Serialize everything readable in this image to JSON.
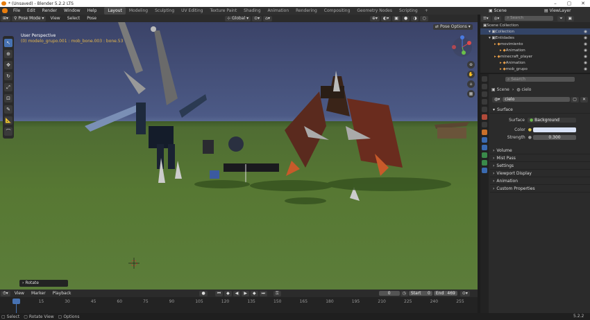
{
  "window": {
    "title": "* (Unsaved) - Blender 5.2.2 LTS",
    "min": "–",
    "max": "▢",
    "close": "✕"
  },
  "menu": [
    "File",
    "Edit",
    "Render",
    "Window",
    "Help"
  ],
  "workspaces": [
    "Layout",
    "Modeling",
    "Sculpting",
    "UV Editing",
    "Texture Paint",
    "Shading",
    "Animation",
    "Rendering",
    "Compositing",
    "Geometry Nodes",
    "Scripting"
  ],
  "active_workspace": "Layout",
  "top_right": {
    "scene": "Scene",
    "view_layer": "ViewLayer"
  },
  "viewport_header": {
    "mode": "Pose Mode",
    "menus": [
      "View",
      "Select",
      "Pose"
    ],
    "transform": "Global",
    "pose_options": "Pose Options"
  },
  "viewport": {
    "perspective": "User Perspective",
    "info": "(0) modelo_grupo.001 : mob_bone.003 : bone.53"
  },
  "last_op": "Rotate",
  "timeline": {
    "menus": [
      "View",
      "Marker",
      "Playback"
    ],
    "current_frame": "0",
    "start_label": "Start",
    "start": "0",
    "end_label": "End",
    "end": "469",
    "ticks": [
      "0",
      "15",
      "30",
      "45",
      "60",
      "75",
      "90",
      "105",
      "120",
      "135",
      "150",
      "165",
      "180",
      "195",
      "210",
      "225",
      "240",
      "255"
    ]
  },
  "statusbar": {
    "select": "Select",
    "rotate_view": "Rotate View",
    "options": "Options",
    "version": "5.2.2"
  },
  "outliner": {
    "search_placeholder": "Search",
    "rows": [
      {
        "label": "Scene Collection",
        "indent": 0
      },
      {
        "label": "Collection",
        "indent": 1
      },
      {
        "label": "Entidades",
        "indent": 1
      },
      {
        "label": "movimiento",
        "indent": 2
      },
      {
        "label": "Animation",
        "indent": 3
      },
      {
        "label": "minecraft_player",
        "indent": 2
      },
      {
        "label": "Animation",
        "indent": 3
      },
      {
        "label": "mob_grupo",
        "indent": 3
      }
    ]
  },
  "properties": {
    "search_placeholder": "Search",
    "breadcrumb": [
      "Scene",
      "cielo"
    ],
    "world_name": "cielo",
    "surface_panel": "Surface",
    "surface_label": "Surface",
    "surface_value": "Background",
    "color_label": "Color",
    "color_value": "#d8e2f6",
    "strength_label": "Strength",
    "strength_value": "0.300",
    "panels": [
      "Volume",
      "Mist Pass",
      "Settings",
      "Viewport Display",
      "Animation",
      "Custom Properties"
    ]
  }
}
